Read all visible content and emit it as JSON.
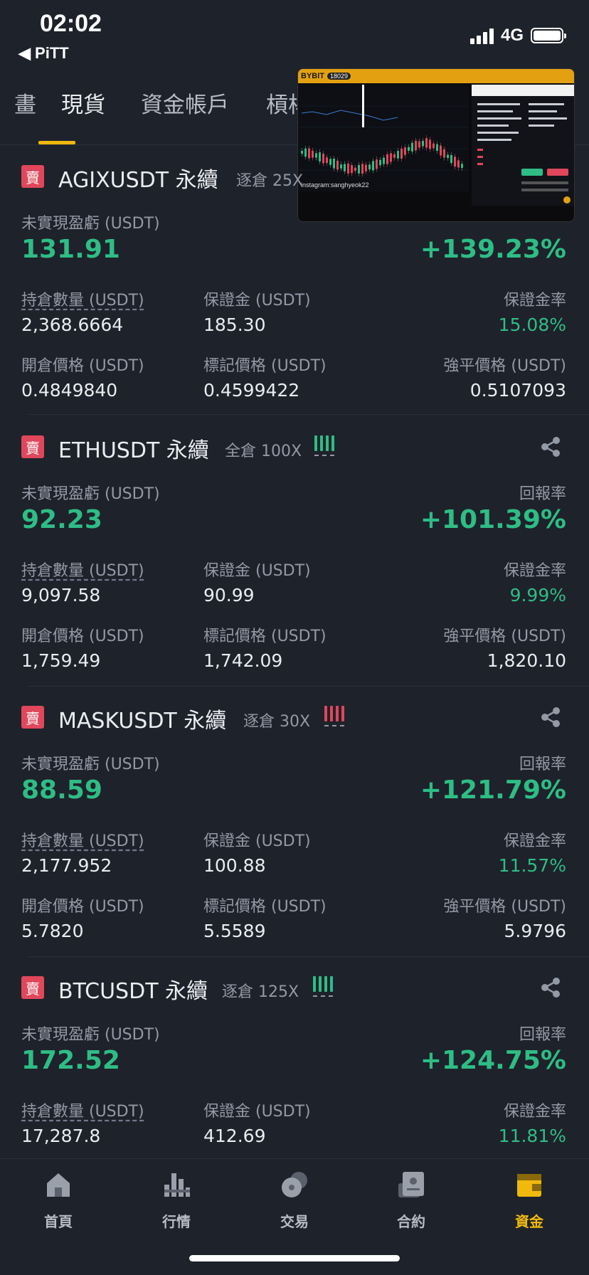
{
  "status": {
    "time": "02:02",
    "back": "◀ PiTT",
    "network": "4G"
  },
  "tabs": [
    {
      "label": "畫"
    },
    {
      "label": "現貨"
    },
    {
      "label": "資金帳戶"
    },
    {
      "label": "槓桿"
    }
  ],
  "pip": {
    "logo": "BYBIT",
    "badge": "18029",
    "handle": "instagram:sanghyeok22"
  },
  "labels": {
    "unrealized": "未實現盈虧 (USDT)",
    "roe": "回報率",
    "size": "持倉數量 (USDT)",
    "margin": "保證金 (USDT)",
    "margin_ratio": "保證金率",
    "entry": "開倉價格 (USDT)",
    "mark": "標記價格 (USDT)",
    "liq": "強平價格 (USDT)"
  },
  "positions": [
    {
      "side": "賣",
      "symbol": "AGIXUSDT 永續",
      "leverage": "逐倉 25X",
      "pnl": "131.91",
      "roe": "+139.23%",
      "size": "2,368.6664",
      "margin": "185.30",
      "margin_ratio": "15.08%",
      "entry": "0.4849840",
      "mark": "0.4599422",
      "liq": "0.5107093"
    },
    {
      "side": "賣",
      "symbol": "ETHUSDT 永續",
      "leverage": "全倉 100X",
      "pnl": "92.23",
      "roe": "+101.39%",
      "size": "9,097.58",
      "margin": "90.99",
      "margin_ratio": "9.99%",
      "entry": "1,759.49",
      "mark": "1,742.09",
      "liq": "1,820.10"
    },
    {
      "side": "賣",
      "symbol": "MASKUSDT 永續",
      "leverage": "逐倉 30X",
      "pnl": "88.59",
      "roe": "+121.79%",
      "size": "2,177.952",
      "margin": "100.88",
      "margin_ratio": "11.57%",
      "entry": "5.7820",
      "mark": "5.5589",
      "liq": "5.9796"
    },
    {
      "side": "賣",
      "symbol": "BTCUSDT 永續",
      "leverage": "逐倉 125X",
      "pnl": "172.52",
      "roe": "+124.75%",
      "size": "17,287.8",
      "margin": "412.69",
      "margin_ratio": "11.81%"
    }
  ],
  "nav": [
    {
      "label": "首頁",
      "icon": "home-icon"
    },
    {
      "label": "行情",
      "icon": "market-bars-icon"
    },
    {
      "label": "交易",
      "icon": "trade-coins-icon"
    },
    {
      "label": "合約",
      "icon": "futures-contract-icon"
    },
    {
      "label": "資金",
      "icon": "wallet-icon",
      "active": true
    }
  ],
  "colors": {
    "green": "#2ebd85",
    "red": "#e0475a",
    "accent": "#f0b90b",
    "bg": "#1e222b"
  }
}
